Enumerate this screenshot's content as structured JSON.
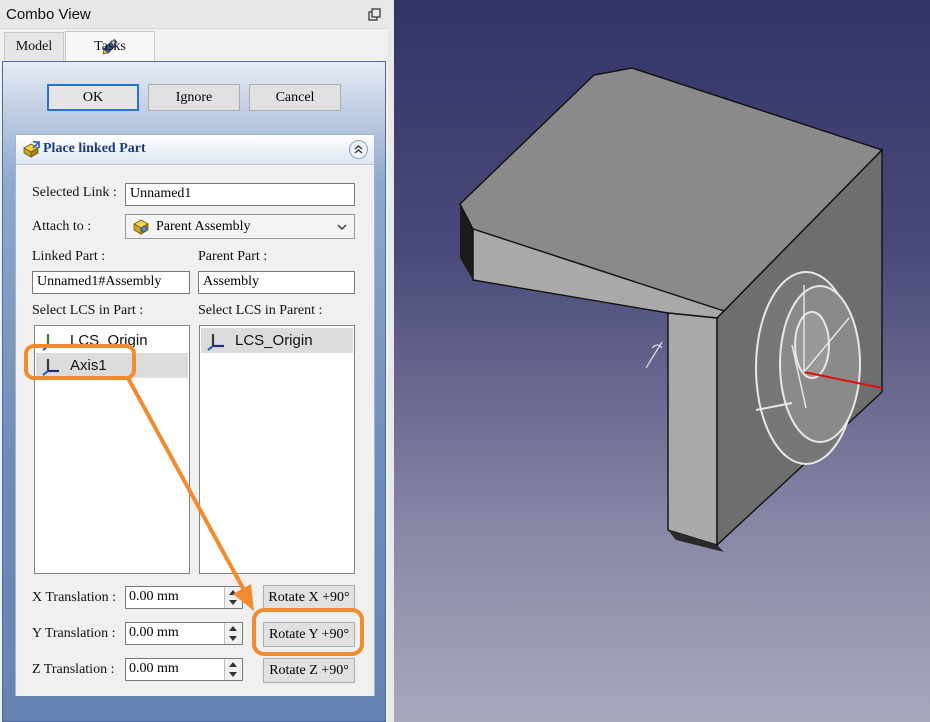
{
  "window": {
    "title": "Combo View"
  },
  "tabs": [
    {
      "label": "Model"
    },
    {
      "label": "Tasks"
    }
  ],
  "buttons": {
    "ok": "OK",
    "ignore": "Ignore",
    "cancel": "Cancel"
  },
  "section": {
    "title": "Place linked Part"
  },
  "form": {
    "selected_link_label": "Selected Link :",
    "selected_link_value": "Unnamed1",
    "attach_to_label": "Attach to :",
    "attach_to_value": "Parent Assembly",
    "linked_part_label": "Linked Part :",
    "linked_part_value": "Unnamed1#Assembly",
    "parent_part_label": "Parent Part :",
    "parent_part_value": "Assembly",
    "select_lcs_part_label": "Select LCS in Part :",
    "select_lcs_parent_label": "Select LCS in Parent :",
    "lcs_part_items": [
      {
        "label": "LCS_Origin",
        "selected": false
      },
      {
        "label": "Axis1",
        "selected": true
      }
    ],
    "lcs_parent_items": [
      {
        "label": "LCS_Origin",
        "selected": true
      }
    ],
    "x_translation_label": "X Translation :",
    "x_translation_value": "0.00 mm",
    "y_translation_label": "Y Translation :",
    "y_translation_value": "0.00 mm",
    "z_translation_label": "Z Translation :",
    "z_translation_value": "0.00 mm",
    "rotate_x_label": "Rotate X +90°",
    "rotate_y_label": "Rotate Y +90°",
    "rotate_z_label": "Rotate Z +90°"
  },
  "colors": {
    "highlight": "#f28a30",
    "view_top": "#333366",
    "view_bottom": "#a8a8bd",
    "section_title": "#1c3d7a"
  }
}
